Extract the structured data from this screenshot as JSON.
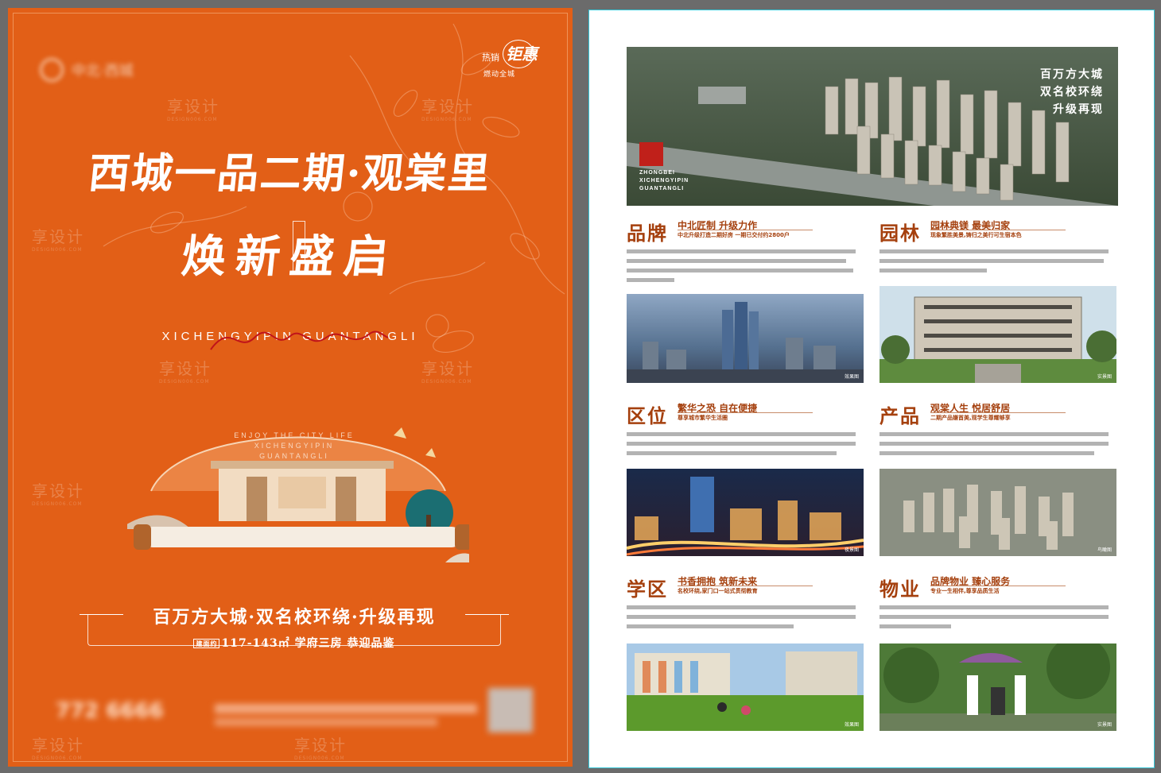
{
  "left_poster": {
    "seal": {
      "line1": "热销",
      "line2": "钜惠",
      "line3": "燃动全城"
    },
    "title_line1": "西城一品二期·观棠里",
    "title_line2": "焕新盛启",
    "pinyin": "XICHENGYIPIN GUANTANGLI",
    "emblem_text": [
      "ENJOY THE CITY LIFE",
      "XICHENGYIPIN",
      "GUANTANGLI"
    ],
    "slogan": "百万方大城·双名校环绕·升级再现",
    "slogan_tag": "建面约",
    "slogan_sub": "117-143㎡ 学府三房 恭迎品鉴",
    "phone_partial": "772 6666",
    "watermark": "享设计",
    "watermark_en": "DESIGN006.COM"
  },
  "right_poster": {
    "hero": {
      "lines": [
        "百万方大城",
        "双名校环绕",
        "升级再现"
      ],
      "caption": [
        "ZHONGBEI",
        "XICHENGYIPIN",
        "GUANTANGLI"
      ]
    },
    "sections": [
      {
        "title": "品牌",
        "subtitle": "中北匠制 升级力作",
        "tagline": "中北升级打造二期好房 一期已交付约2800户"
      },
      {
        "title": "园林",
        "subtitle": "园林典镁 最美归家",
        "tagline": "现象繁胜美景,铸归之美行可生宿本色"
      },
      {
        "title": "区位",
        "subtitle": "繁华之恐 自在便捷",
        "tagline": "尊享城市繁华生活圈"
      },
      {
        "title": "产品",
        "subtitle": "观棠人生 悦居舒居",
        "tagline": "二期产品嫌首美,观学生尊耀够享"
      },
      {
        "title": "学区",
        "subtitle": "书香拥抱 筑新未来",
        "tagline": "名校环绕,家门口一站式贯彻教育"
      },
      {
        "title": "物业",
        "subtitle": "品牌物业 臻心服务",
        "tagline": "专业一生相伴,尊享品质生活"
      }
    ],
    "image_labels": [
      "效果图",
      "实景图",
      "夜景图",
      "鸟瞰图",
      "效果图",
      "实景图"
    ]
  },
  "colors": {
    "poster_orange": "#e25f17",
    "section_brown": "#a5400e",
    "guide_cyan": "#34c6d8"
  }
}
